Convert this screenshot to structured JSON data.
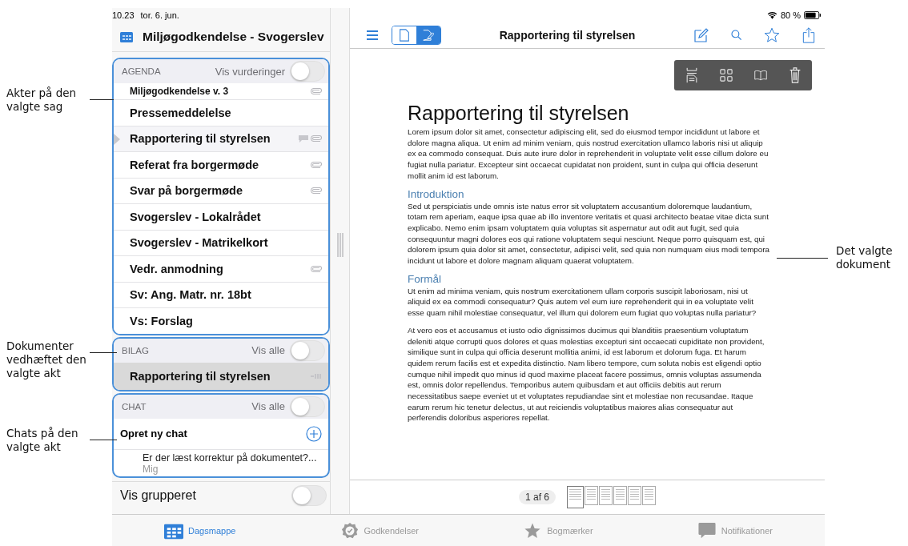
{
  "annotations": {
    "left": [
      {
        "label": "Akter på den valgte sag"
      },
      {
        "label": "Dokumenter vedhæftet den valgte akt"
      },
      {
        "label": "Chats på den valgte akt"
      }
    ],
    "right": [
      {
        "label": "Det valgte dokument"
      }
    ]
  },
  "status_bar": {
    "time": "10.23",
    "date": "tor. 6. jun.",
    "battery": "80 %"
  },
  "sidebar": {
    "title": "Miljøgodkendelse - Svogerslev",
    "agenda": {
      "heading": "AGENDA",
      "toggle_label": "Vis vurderinger",
      "on": false,
      "items": [
        {
          "title": "Miljøgodkendelse v. 3",
          "selected": false,
          "attachment": true,
          "comment": false
        },
        {
          "title": "Pressemeddelelse",
          "selected": false,
          "attachment": false,
          "comment": false
        },
        {
          "title": "Rapportering til styrelsen",
          "selected": true,
          "attachment": true,
          "comment": true
        },
        {
          "title": "Referat fra borgermøde",
          "selected": false,
          "attachment": true,
          "comment": false
        },
        {
          "title": "Svar på borgermøde",
          "selected": false,
          "attachment": true,
          "comment": false
        },
        {
          "title": "Svogerslev - Lokalrådet",
          "selected": false,
          "attachment": false,
          "comment": false
        },
        {
          "title": "Svogerslev - Matrikelkort",
          "selected": false,
          "attachment": false,
          "comment": false
        },
        {
          "title": "Vedr. anmodning",
          "selected": false,
          "attachment": true,
          "comment": false
        },
        {
          "title": "Sv: Ang. Matr. nr. 18bt",
          "selected": false,
          "attachment": false,
          "comment": false
        },
        {
          "title": "Vs: Forslag",
          "selected": false,
          "attachment": false,
          "comment": false
        }
      ]
    },
    "attachments": {
      "heading": "BILAG",
      "toggle_label": "Vis alle",
      "on": false,
      "items": [
        {
          "title": "Rapportering til styrelsen",
          "selected": true
        }
      ]
    },
    "chat": {
      "heading": "CHAT",
      "toggle_label": "Vis alle",
      "on": false,
      "new_chat": "Opret ny chat",
      "threads": [
        {
          "message": "Er der læst korrektur på dokumentet?...",
          "author": "Mig"
        }
      ]
    },
    "group_toggle": {
      "label": "Vis grupperet",
      "on": false
    }
  },
  "toolbar": {
    "view_modes": [
      {
        "kind": "document",
        "selected": false
      },
      {
        "kind": "annotate",
        "selected": true
      }
    ],
    "title": "Rapportering til styrelsen"
  },
  "document": {
    "title": "Rapportering til styrelsen",
    "blocks": [
      {
        "kind": "paragraph",
        "text": "Lorem ipsum dolor sit amet, consectetur adipiscing elit, sed do eiusmod tempor incididunt ut labore et dolore magna aliqua. Ut enim ad minim veniam, quis nostrud exercitation ullamco laboris nisi ut aliquip ex ea commodo consequat. Duis aute irure dolor in reprehenderit in voluptate velit esse cillum dolore eu fugiat nulla pariatur. Excepteur sint occaecat cupidatat non proident, sunt in culpa qui officia deserunt mollit anim id est laborum."
      },
      {
        "kind": "heading",
        "text": "Introduktion"
      },
      {
        "kind": "paragraph",
        "text": "Sed ut perspiciatis unde omnis iste natus error sit voluptatem accusantium doloremque laudantium, totam rem aperiam, eaque ipsa quae ab illo inventore veritatis et quasi architecto beatae vitae dicta sunt explicabo. Nemo enim ipsam voluptatem quia voluptas sit aspernatur aut odit aut fugit, sed quia consequuntur magni dolores eos qui ratione voluptatem sequi nesciunt. Neque porro quisquam est, qui dolorem ipsum quia dolor sit amet, consectetur, adipisci velit, sed quia non numquam eius modi tempora incidunt ut labore et dolore magnam aliquam quaerat voluptatem."
      },
      {
        "kind": "heading",
        "text": "Formål"
      },
      {
        "kind": "paragraph",
        "text": "Ut enim ad minima veniam, quis nostrum exercitationem ullam corporis suscipit laboriosam, nisi ut aliquid ex ea commodi consequatur? Quis autem vel eum iure reprehenderit qui in ea voluptate velit esse quam nihil molestiae consequatur, vel illum qui dolorem eum fugiat quo voluptas nulla pariatur?"
      },
      {
        "kind": "paragraph",
        "text": "At vero eos et accusamus et iusto odio dignissimos ducimus qui blanditiis praesentium voluptatum deleniti atque corrupti quos dolores et quas molestias excepturi sint occaecati cupiditate non provident, similique sunt in culpa qui officia deserunt mollitia animi, id est laborum et dolorum fuga. Et harum quidem rerum facilis est et expedita distinctio. Nam libero tempore, cum soluta nobis est eligendi optio cumque nihil impedit quo minus id quod maxime placeat facere possimus, omnis voluptas assumenda est, omnis dolor repellendus. Temporibus autem quibusdam et aut officiis debitis aut rerum necessitatibus saepe eveniet ut et voluptates repudiandae sint et molestiae non recusandae. Itaque earum rerum hic tenetur delectus, ut aut reiciendis voluptatibus maiores alias consequatur aut perferendis doloribus asperiores repellat."
      }
    ]
  },
  "pager": {
    "page_label": "1 af 6",
    "thumbnails": [
      {
        "selected": true
      },
      {
        "selected": false
      },
      {
        "selected": false
      },
      {
        "selected": false
      },
      {
        "selected": false
      },
      {
        "selected": false
      }
    ]
  },
  "tab_bar": [
    {
      "kind": "calendar",
      "label": "Dagsmappe",
      "selected": true
    },
    {
      "kind": "approval",
      "label": "Godkendelser",
      "selected": false
    },
    {
      "kind": "star",
      "label": "Bogmærker",
      "selected": false
    },
    {
      "kind": "bubble",
      "label": "Notifikationer",
      "selected": false
    }
  ]
}
